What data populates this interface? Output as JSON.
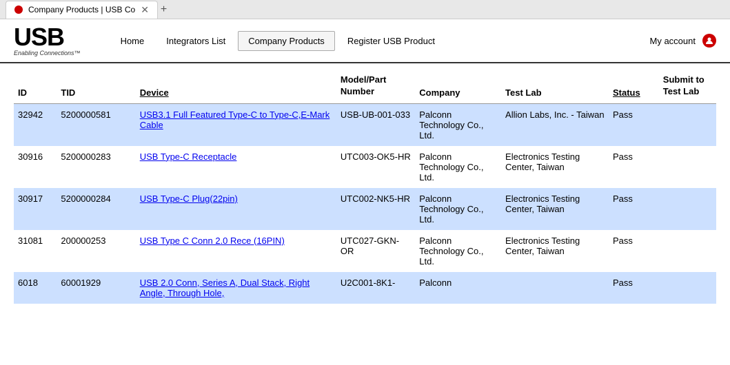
{
  "browser": {
    "tab_label": "Company Products | USB Co",
    "new_tab_label": "+"
  },
  "header": {
    "logo_text": "USB",
    "logo_tagline": "Enabling Connections™",
    "nav": [
      {
        "label": "Home",
        "active": false
      },
      {
        "label": "Integrators List",
        "active": false
      },
      {
        "label": "Company Products",
        "active": true
      },
      {
        "label": "Register USB Product",
        "active": false
      }
    ],
    "my_account": "My account"
  },
  "table": {
    "columns": [
      {
        "key": "id",
        "label": "ID",
        "underline": false
      },
      {
        "key": "tid",
        "label": "TID",
        "underline": false
      },
      {
        "key": "device",
        "label": "Device",
        "underline": true
      },
      {
        "key": "model",
        "label": "Model/Part\nNumber",
        "underline": false
      },
      {
        "key": "company",
        "label": "Company",
        "underline": false
      },
      {
        "key": "testlab",
        "label": "Test Lab",
        "underline": false
      },
      {
        "key": "status",
        "label": "Status",
        "underline": true
      },
      {
        "key": "submit",
        "label": "Submit to\nTest Lab",
        "underline": false
      }
    ],
    "rows": [
      {
        "id": "32942",
        "tid": "5200000581",
        "device": "USB3.1 Full Featured Type-C to Type-C,E-Mark Cable",
        "model": "USB-UB-001-033",
        "company": "Palconn Technology Co., Ltd.",
        "testlab": "Allion Labs, Inc. - Taiwan",
        "status": "Pass",
        "submit": "",
        "striped": true
      },
      {
        "id": "30916",
        "tid": "5200000283",
        "device": "USB Type-C Receptacle",
        "model": "UTC003-OK5-HR",
        "company": "Palconn Technology Co., Ltd.",
        "testlab": "Electronics Testing Center, Taiwan",
        "status": "Pass",
        "submit": "",
        "striped": false
      },
      {
        "id": "30917",
        "tid": "5200000284",
        "device": "USB Type-C Plug(22pin)",
        "model": "UTC002-NK5-HR",
        "company": "Palconn Technology Co., Ltd.",
        "testlab": "Electronics Testing Center, Taiwan",
        "status": "Pass",
        "submit": "",
        "striped": true
      },
      {
        "id": "31081",
        "tid": "200000253",
        "device": "USB Type C Conn 2.0 Rece (16PIN)",
        "model": "UTC027-GKN-OR",
        "company": "Palconn Technology Co., Ltd.",
        "testlab": "Electronics Testing Center, Taiwan",
        "status": "Pass",
        "submit": "",
        "striped": false
      },
      {
        "id": "6018",
        "tid": "60001929",
        "device": "USB 2.0 Conn, Series A, Dual Stack, Right Angle, Through Hole,",
        "model": "U2C001-8K1-",
        "company": "Palconn",
        "testlab": "",
        "status": "Pass",
        "submit": "",
        "striped": true
      }
    ]
  }
}
